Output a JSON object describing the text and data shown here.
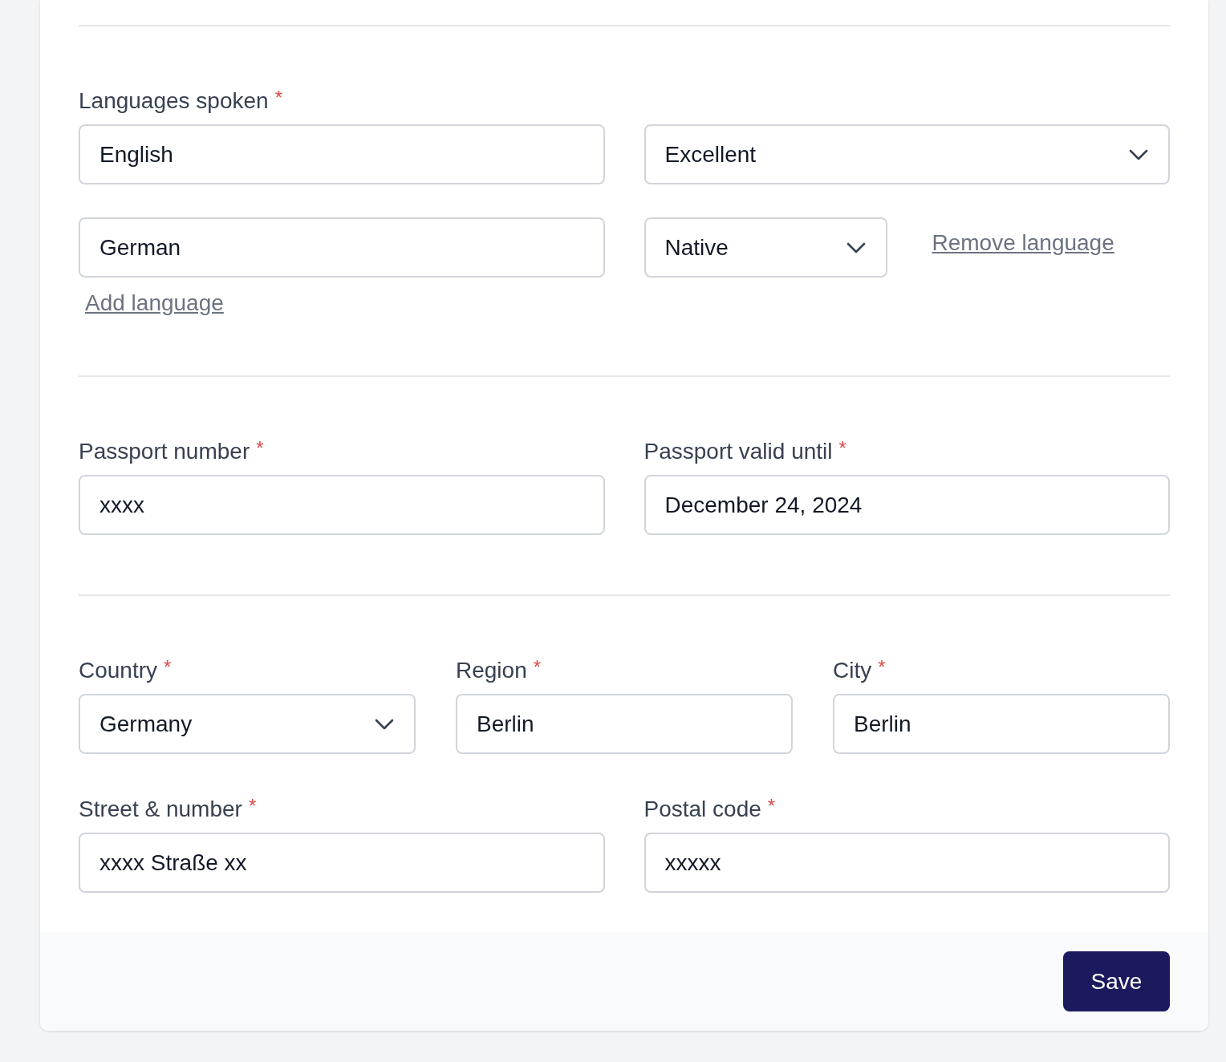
{
  "languages": {
    "label": "Languages spoken",
    "required_mark": "*",
    "entries": [
      {
        "language": "English",
        "proficiency": "Excellent"
      },
      {
        "language": "German",
        "proficiency": "Native",
        "remove_label": "Remove language"
      }
    ],
    "add_label": "Add language"
  },
  "passport": {
    "fields": [
      {
        "label": "Passport number",
        "required_mark": "*",
        "kind": "input",
        "value": "xxxx"
      },
      {
        "label": "Passport valid until",
        "required_mark": "*",
        "kind": "input",
        "value": "December 24, 2024"
      }
    ]
  },
  "address": {
    "rows": [
      [
        {
          "label": "Country",
          "required_mark": "*",
          "kind": "select",
          "value": "Germany"
        },
        {
          "label": "Region",
          "required_mark": "*",
          "kind": "input",
          "value": "Berlin"
        },
        {
          "label": "City",
          "required_mark": "*",
          "kind": "input",
          "value": "Berlin"
        }
      ],
      [
        {
          "label": "Street & number",
          "required_mark": "*",
          "kind": "input",
          "value": "xxxx Straße xx"
        },
        {
          "label": "Postal code",
          "required_mark": "*",
          "kind": "input",
          "value": "xxxxx"
        }
      ]
    ]
  },
  "footer": {
    "save_label": "Save"
  }
}
